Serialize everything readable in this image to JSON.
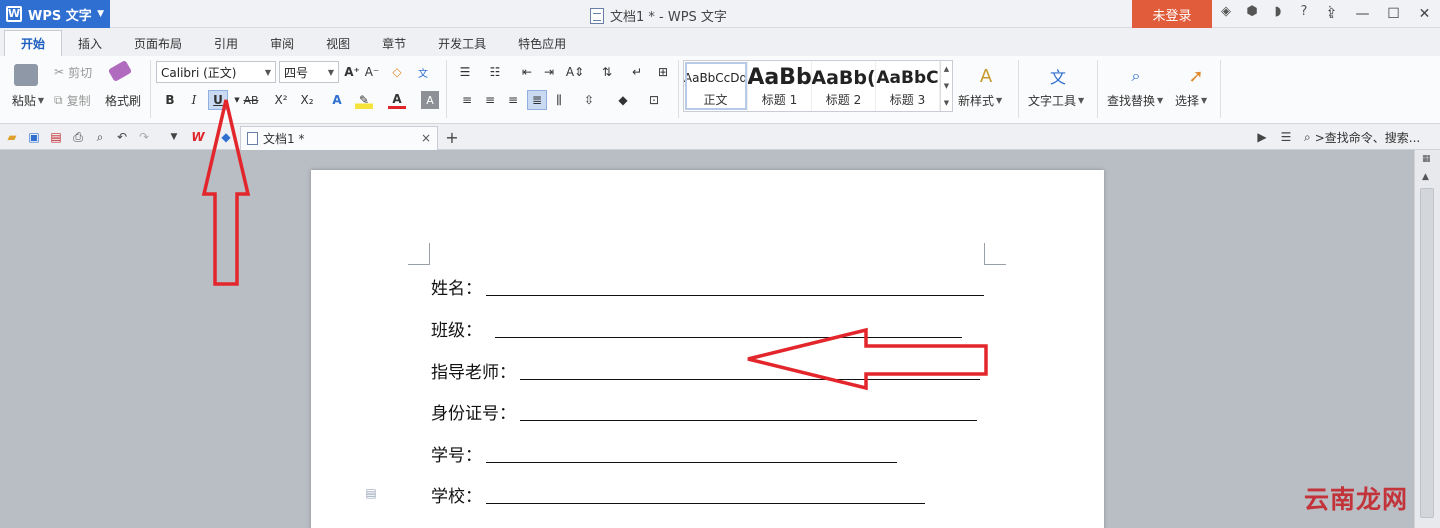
{
  "titlebar": {
    "app_name": "WPS 文字",
    "app_logo_letter": "W",
    "document_title": "文档1 * - WPS 文字",
    "login_label": "未登录"
  },
  "ribbon_tabs": [
    "开始",
    "插入",
    "页面布局",
    "引用",
    "审阅",
    "视图",
    "章节",
    "开发工具",
    "特色应用"
  ],
  "clipboard": {
    "paste": "粘贴",
    "cut": "剪切",
    "copy": "复制",
    "format_painter": "格式刷"
  },
  "font": {
    "family_value": "Calibri (正文)",
    "size_value": "四号",
    "bold": "B",
    "italic": "I",
    "underline": "U",
    "strikethrough": "AB",
    "superscript": "X²",
    "subscript": "X₂"
  },
  "styles": {
    "items": [
      {
        "preview": "AaBbCcDd",
        "label": "正文"
      },
      {
        "preview": "AaBb",
        "label": "标题 1"
      },
      {
        "preview": "AaBb(",
        "label": "标题 2"
      },
      {
        "preview": "AaBbC",
        "label": "标题 3"
      }
    ],
    "new_style": "新样式",
    "text_tools": "文字工具",
    "find_replace": "查找替换",
    "select": "选择"
  },
  "doc_tab": {
    "label": "文档1 *",
    "close": "×",
    "add": "+"
  },
  "search_command": ">查找命令、搜索...",
  "document": {
    "fields": [
      {
        "label": "姓名："
      },
      {
        "label": "班级："
      },
      {
        "label": "指导老师："
      },
      {
        "label": "身份证号："
      },
      {
        "label": "学号："
      },
      {
        "label": "学校："
      }
    ]
  },
  "watermark": "云南龙网",
  "colors": {
    "app_blue": "#2f6fd1",
    "login_orange": "#e05c3a",
    "annotation_red": "#e3262b"
  }
}
